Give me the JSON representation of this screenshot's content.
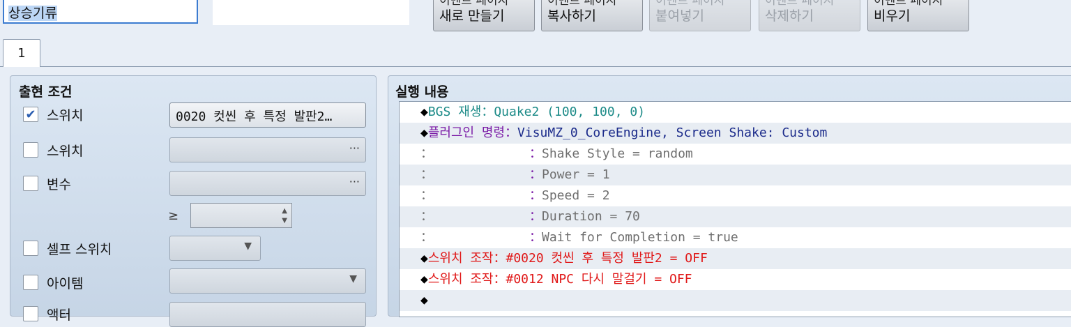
{
  "event_name": {
    "value": "상승기류"
  },
  "toolbar": {
    "buttons": [
      {
        "line1": "이벤트 페이지",
        "line2": "새로 만들기",
        "disabled": false
      },
      {
        "line1": "이벤트 페이지",
        "line2": "복사하기",
        "disabled": false
      },
      {
        "line1": "이벤트 페이지",
        "line2": "붙여넣기",
        "disabled": true
      },
      {
        "line1": "이벤트 페이지",
        "line2": "삭제하기",
        "disabled": true
      },
      {
        "line1": "이벤트 페이지",
        "line2": "비우기",
        "disabled": false
      }
    ]
  },
  "tabs": [
    {
      "label": "1"
    }
  ],
  "conditions": {
    "title": "출현 조건",
    "switch1": {
      "label": "스위치",
      "checked": "✔",
      "value": "0020 컷씬 후 특정 발판2…"
    },
    "switch2": {
      "label": "스위치",
      "dots": "···"
    },
    "variable": {
      "label": "변수",
      "dots": "···",
      "operator": "≥"
    },
    "self_switch": {
      "label": "셀프 스위치",
      "arrow": "▼"
    },
    "item": {
      "label": "아이템",
      "arrow": "▼"
    },
    "actor": {
      "label": "액터"
    }
  },
  "contents": {
    "title": "실행 내용",
    "commands": [
      {
        "prefix": "◆",
        "name": "BGS 재생",
        "sep": "：",
        "text": "Quake2 (100, 100, 0)"
      },
      {
        "prefix": "◆",
        "name": "플러그인 명령",
        "sep": "：",
        "text": "VisuMZ_0_CoreEngine, Screen Shake: Custom"
      },
      {
        "prefix": "：",
        "sep": "：",
        "text": "Shake Style = random"
      },
      {
        "prefix": "：",
        "sep": "：",
        "text": "Power = 1"
      },
      {
        "prefix": "：",
        "sep": "：",
        "text": "Speed = 2"
      },
      {
        "prefix": "：",
        "sep": "：",
        "text": "Duration = 70"
      },
      {
        "prefix": "：",
        "sep": "：",
        "text": "Wait for Completion = true"
      },
      {
        "prefix": "◆",
        "name": "스위치 조작",
        "sep": "：",
        "text": "#0020 컷씬 후 특정 발판2 = OFF"
      },
      {
        "prefix": "◆",
        "name": "스위치 조작",
        "sep": "：",
        "text": "#0012 NPC 다시 말걸기 = OFF"
      },
      {
        "prefix": "◆"
      }
    ]
  },
  "colors": {
    "accent": "#3b7bd0",
    "teal": "#1b8a87",
    "purple": "#7a1aa6",
    "red": "#e01818"
  }
}
